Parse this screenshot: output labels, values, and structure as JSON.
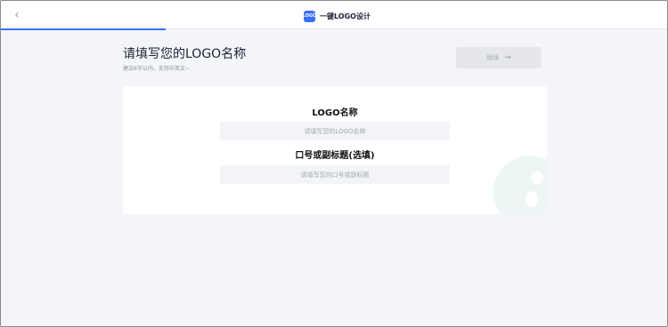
{
  "header": {
    "back_glyph": "‹",
    "brand_logo_text": "LOGO",
    "brand_name": "一键LOGO设计",
    "accent_color": "#3a6ff7"
  },
  "page": {
    "title": "请填写您的LOGO名称",
    "subtitle": "建议6字以内，支持中英文~",
    "next_button_label": "继续",
    "next_button_arrow": "→"
  },
  "form": {
    "name_label": "LOGO名称",
    "name_placeholder": "请填写您的LOGO名称",
    "slogan_label": "口号或副标题(选填)",
    "slogan_placeholder": "请填写您的口号或副标题"
  }
}
